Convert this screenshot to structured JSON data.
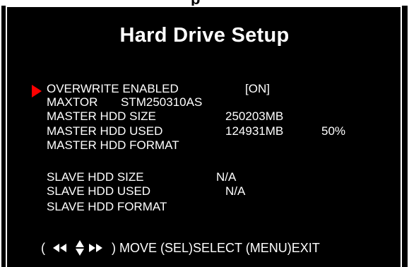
{
  "top_partial_text": "p",
  "screen": {
    "title": "Hard Drive Setup",
    "menu": {
      "overwrite": {
        "label": "OVERWRITE ENABLED",
        "value": "[ON]"
      },
      "drive_model": {
        "brand": "MAXTOR",
        "model": "STM250310AS"
      },
      "master_size": {
        "label": "MASTER HDD SIZE",
        "value": "250203MB"
      },
      "master_used": {
        "label": "MASTER HDD USED",
        "value": "124931MB",
        "percent": "50%"
      },
      "master_format": {
        "label": "MASTER HDD FORMAT"
      },
      "slave_size": {
        "label": "SLAVE HDD SIZE",
        "value": "N/A"
      },
      "slave_used": {
        "label": "SLAVE HDD USED",
        "value": "N/A"
      },
      "slave_format": {
        "label": "SLAVE HDD FORMAT"
      }
    },
    "footer": {
      "open_paren": "(",
      "hint": ") MOVE (SEL)SELECT (MENU)EXIT",
      "nav_icon": "four-way-arrows-icon"
    }
  },
  "colors": {
    "background": "#000000",
    "text": "#ffffff",
    "cursor": "#ff0000"
  }
}
